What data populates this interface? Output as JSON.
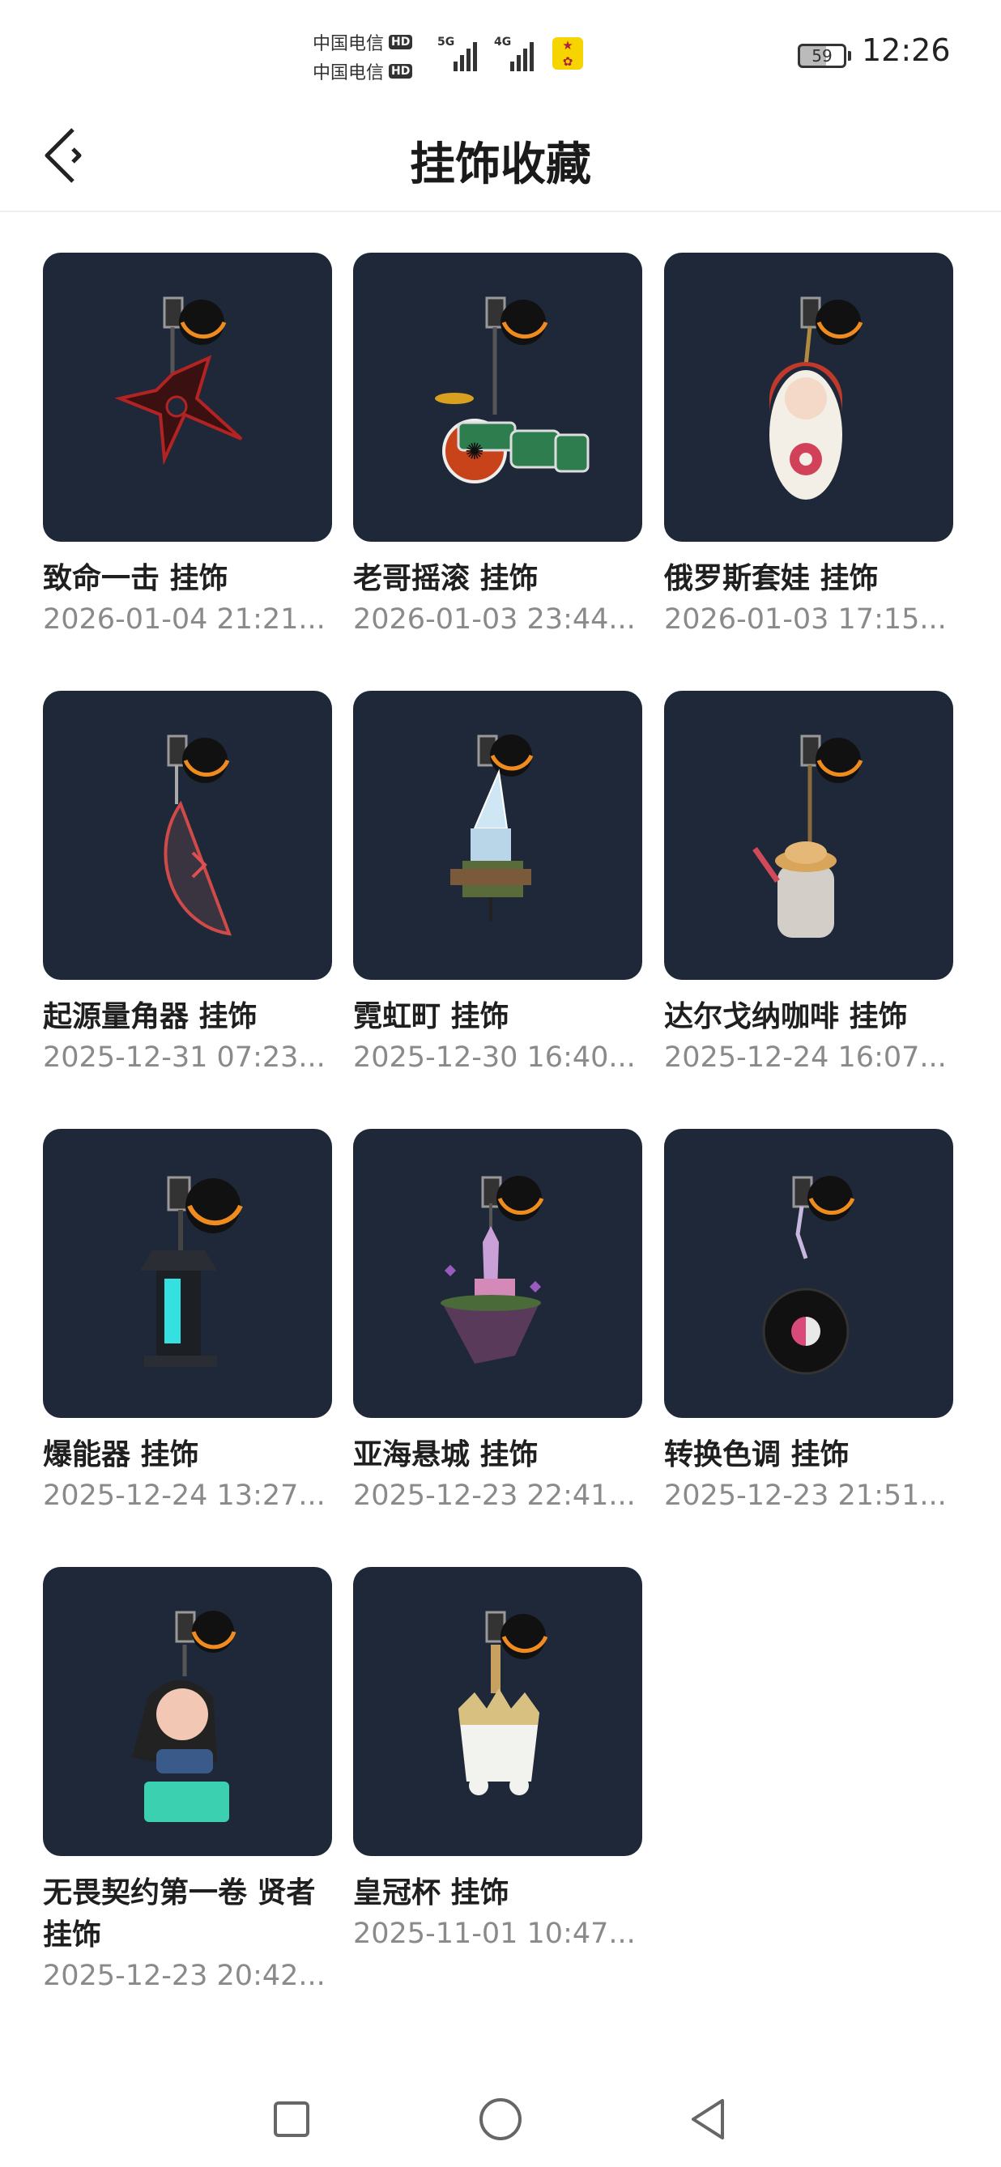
{
  "status_bar": {
    "carrier_1": "中国电信",
    "carrier_2": "中国电信",
    "hd_badge": "HD",
    "network_1": "5G",
    "network_2": "4G",
    "battery_level": 59,
    "battery_text": "59",
    "time": "12:26"
  },
  "header": {
    "title": "挂饰收藏",
    "back_icon": "back-arrow-icon"
  },
  "items": [
    {
      "name": "致命一击 挂饰",
      "date": "2026-01-04 21:21..."
    },
    {
      "name": "老哥摇滚 挂饰",
      "date": "2026-01-03 23:44..."
    },
    {
      "name": "俄罗斯套娃 挂饰",
      "date": "2026-01-03 17:15..."
    },
    {
      "name": "起源量角器 挂饰",
      "date": "2025-12-31 07:23..."
    },
    {
      "name": "霓虹町 挂饰",
      "date": "2025-12-30 16:40..."
    },
    {
      "name": "达尔戈纳咖啡 挂饰",
      "date": "2025-12-24 16:07..."
    },
    {
      "name": "爆能器 挂饰",
      "date": "2025-12-24 13:27..."
    },
    {
      "name": "亚海悬城 挂饰",
      "date": "2025-12-23 22:41..."
    },
    {
      "name": "转换色调 挂饰",
      "date": "2025-12-23 21:51..."
    },
    {
      "name": "无畏契约第一卷 贤者 挂饰",
      "date": "2025-12-23 20:42..."
    },
    {
      "name": "皇冠杯 挂饰",
      "date": "2025-11-01 10:47..."
    }
  ],
  "colors": {
    "thumb_bg": "#1e2838",
    "accent_orange": "#f08c1e"
  },
  "navbar": {
    "recent_icon": "square-recent-icon",
    "home_icon": "circle-home-icon",
    "back_icon": "triangle-back-icon"
  }
}
